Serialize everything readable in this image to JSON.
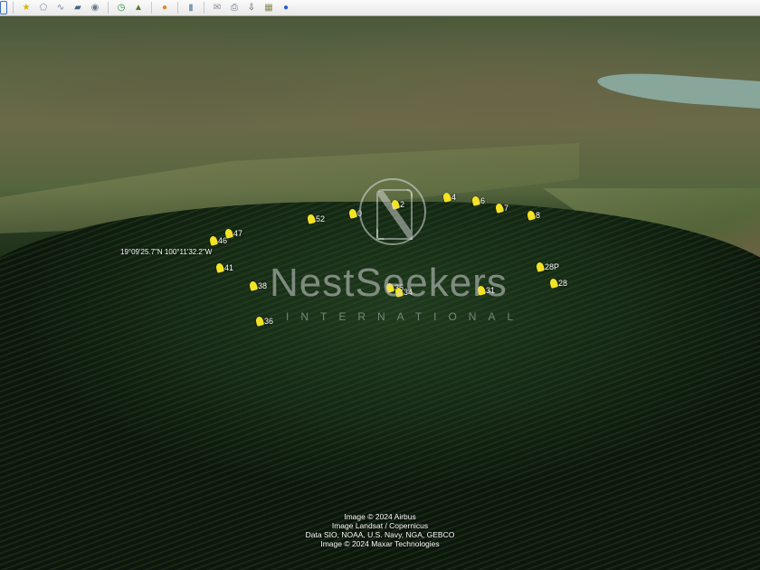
{
  "toolbar": {
    "items": [
      "sidebar-toggle-icon",
      "placemark-icon",
      "polygon-icon",
      "path-icon",
      "image-overlay-icon",
      "record-tour-icon",
      "historical-imagery-icon",
      "sunlight-icon",
      "planets-icon",
      "ruler-icon",
      "email-icon",
      "print-icon",
      "save-image-icon",
      "map-icon",
      "earth-icon"
    ]
  },
  "placemarks": [
    {
      "label": "52"
    },
    {
      "label": "0"
    },
    {
      "label": "2"
    },
    {
      "label": "4"
    },
    {
      "label": "6"
    },
    {
      "label": "7"
    },
    {
      "label": "8"
    },
    {
      "label": "46"
    },
    {
      "label": "47"
    },
    {
      "label": "41"
    },
    {
      "label": "38"
    },
    {
      "label": "35"
    },
    {
      "label": "34"
    },
    {
      "label": "31"
    },
    {
      "label": "28P"
    },
    {
      "label": "28"
    },
    {
      "label": "36"
    }
  ],
  "coordinate_label": "19°09'25.7\"N 100°11'32.2\"W",
  "watermark": {
    "name": "NestSeekers",
    "sub": "INTERNATIONAL"
  },
  "credits": [
    "Image © 2024 Airbus",
    "Image Landsat / Copernicus",
    "Data SIO, NOAA, U.S. Navy, NGA, GEBCO",
    "Image © 2024 Maxar Technologies"
  ],
  "colors": {
    "pin": "#f3e326",
    "toolbar": "#f2f2f2"
  }
}
